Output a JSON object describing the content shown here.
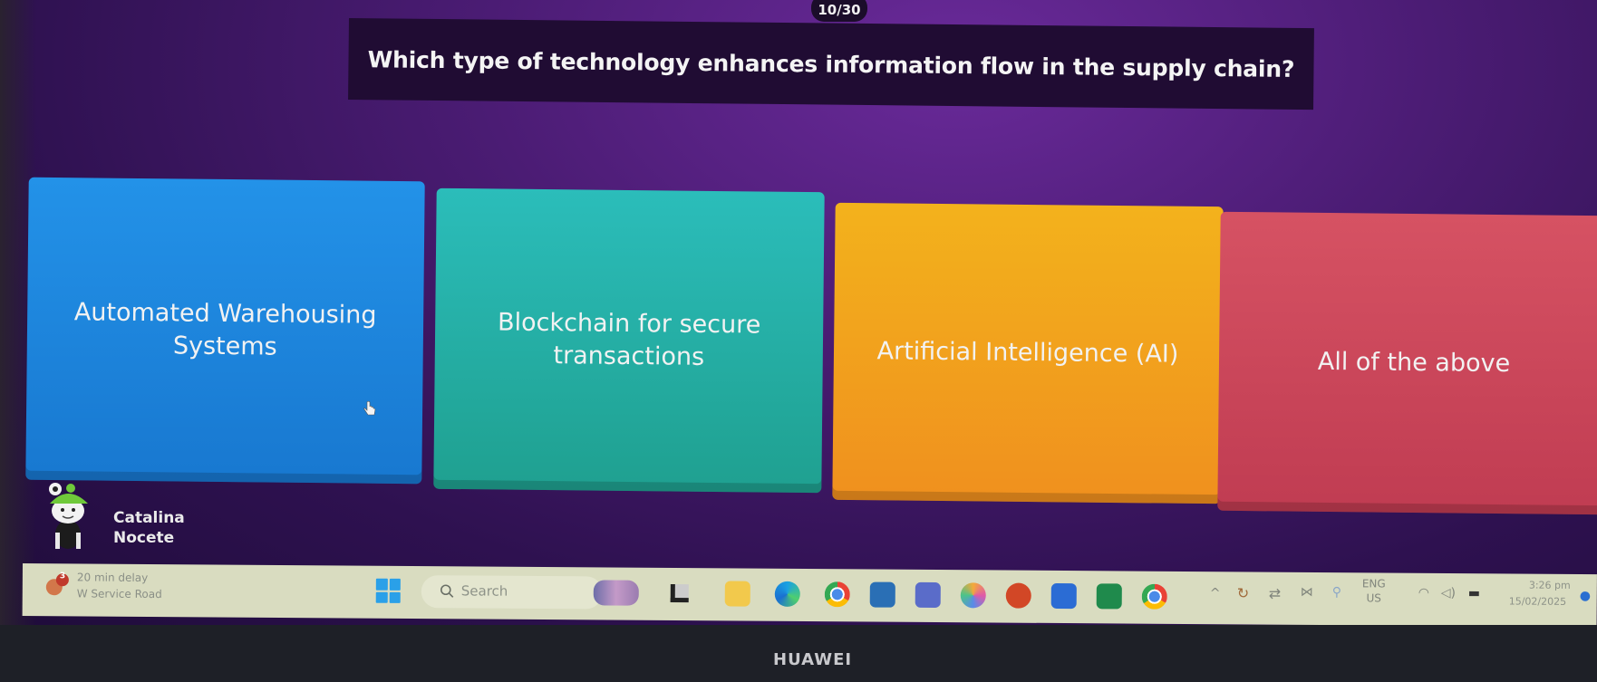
{
  "quiz": {
    "counter": "10/30",
    "question": "Which type of technology enhances information flow in the supply chain?",
    "answers": [
      {
        "label": "Automated Warehousing Systems",
        "color": "#1f86df"
      },
      {
        "label": "Blockchain for secure transactions",
        "color": "#25afa6"
      },
      {
        "label": "Artificial Intelligence (AI)",
        "color": "#f2a01d"
      },
      {
        "label": "All of the above",
        "color": "#cc475a"
      }
    ],
    "player": {
      "first_name": "Catalina",
      "last_name": "Nocete",
      "avatar": "frog-hat-avatar"
    }
  },
  "taskbar": {
    "weather": {
      "badge": "3",
      "line1": "20 min delay",
      "line2": "W Service Road",
      "icon": "traffic-icon"
    },
    "search_placeholder": "Search",
    "apps": [
      {
        "name": "widgets",
        "icon": "widgets-icon"
      },
      {
        "name": "task-view",
        "icon": "task-view-icon"
      },
      {
        "name": "file-explorer",
        "icon": "folder-icon"
      },
      {
        "name": "edge",
        "icon": "edge-icon"
      },
      {
        "name": "chrome",
        "icon": "chrome-icon"
      },
      {
        "name": "store",
        "icon": "store-icon"
      },
      {
        "name": "teams",
        "icon": "teams-icon"
      },
      {
        "name": "copilot",
        "icon": "copilot-icon"
      },
      {
        "name": "powerpoint",
        "icon": "powerpoint-icon"
      },
      {
        "name": "word",
        "icon": "word-icon"
      },
      {
        "name": "excel",
        "icon": "excel-icon"
      },
      {
        "name": "chrome-profile",
        "icon": "chrome-icon"
      }
    ],
    "tray": {
      "language_top": "ENG",
      "language_bottom": "US",
      "time": "3:26 pm",
      "date": "15/02/2025"
    }
  },
  "device": {
    "brand": "HUAWEI"
  },
  "colors": {
    "background": "#3a1760",
    "question_bar": "#200c33",
    "taskbar": "#d9dcc0"
  }
}
